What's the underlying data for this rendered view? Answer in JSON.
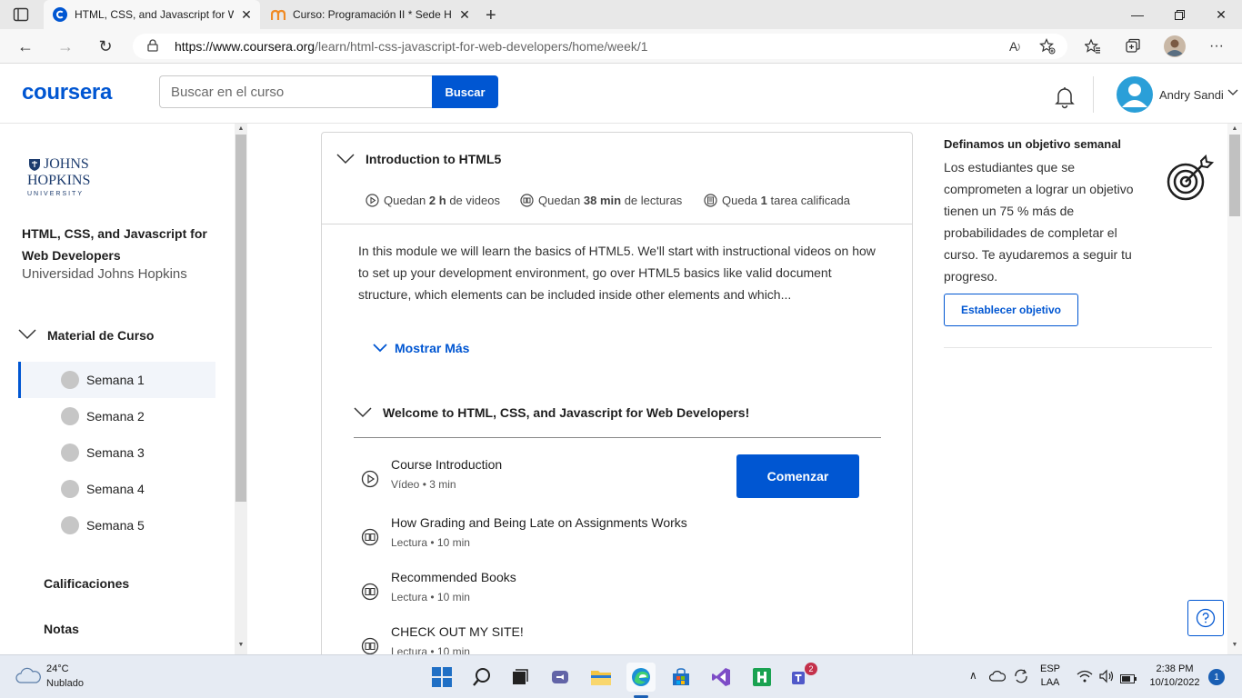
{
  "browser": {
    "tabs": [
      {
        "title": "HTML, CSS, and Javascript for We",
        "active": true
      },
      {
        "title": "Curso: Programación II * Sede He",
        "active": false
      }
    ],
    "url_host": "https://www.coursera.org",
    "url_path": "/learn/html-css-javascript-for-web-developers/home/week/1"
  },
  "header": {
    "logo": "coursera",
    "search_placeholder": "Buscar en el curso",
    "search_button": "Buscar",
    "user_name": "Andry Sandi"
  },
  "sidebar": {
    "university_logo": {
      "line1": "JOHNS",
      "line2": "HOPKINS",
      "line3": "UNIVERSITY"
    },
    "course_name": "HTML, CSS, and Javascript for Web Developers",
    "university": "Universidad Johns Hopkins",
    "material_label": "Material de Curso",
    "weeks": [
      "Semana 1",
      "Semana 2",
      "Semana 3",
      "Semana 4",
      "Semana 5"
    ],
    "selected_week": 0,
    "grades_label": "Calificaciones",
    "notes_label": "Notas"
  },
  "module": {
    "title": "Introduction to HTML5",
    "stats": [
      {
        "icon": "play-circle-icon",
        "prefix": "Quedan ",
        "bold": "2 h",
        "suffix": " de videos"
      },
      {
        "icon": "reading-icon",
        "prefix": "Quedan ",
        "bold": "38 min",
        "suffix": " de lecturas"
      },
      {
        "icon": "assignment-icon",
        "prefix": "Queda ",
        "bold": "1",
        "suffix": " tarea calificada"
      }
    ],
    "description": "In this module we will learn the basics of HTML5. We'll start with instructional videos on how to set up your development environment, go over HTML5 basics like valid document structure, which elements can be included inside other elements and which...",
    "show_more": "Mostrar Más",
    "lesson_title": "Welcome to HTML, CSS, and Javascript for Web Developers!",
    "items": [
      {
        "title": "Course Introduction",
        "meta": "Vídeo • 3 min",
        "icon": "play-circle-icon"
      },
      {
        "title": "How Grading and Being Late on Assignments Works",
        "meta": "Lectura • 10 min",
        "icon": "reading-icon"
      },
      {
        "title": "Recommended Books",
        "meta": "Lectura • 10 min",
        "icon": "reading-icon"
      },
      {
        "title": "CHECK OUT MY SITE!",
        "meta": "Lectura • 10 min",
        "icon": "reading-icon"
      }
    ],
    "start_button": "Comenzar"
  },
  "goal": {
    "title": "Definamos un objetivo semanal",
    "text": "Los estudiantes que se comprometen a lograr un objetivo tienen un 75 % más de probabilidades de completar el curso. Te ayudaremos a seguir tu progreso.",
    "button": "Establecer objetivo"
  },
  "taskbar": {
    "temperature": "24°C",
    "weather": "Nublado",
    "lang_top": "ESP",
    "lang_bottom": "LAA",
    "time": "2:38 PM",
    "date": "10/10/2022",
    "notifications": "1",
    "teams_badge": "2"
  },
  "colors": {
    "brand": "#0056d2"
  }
}
